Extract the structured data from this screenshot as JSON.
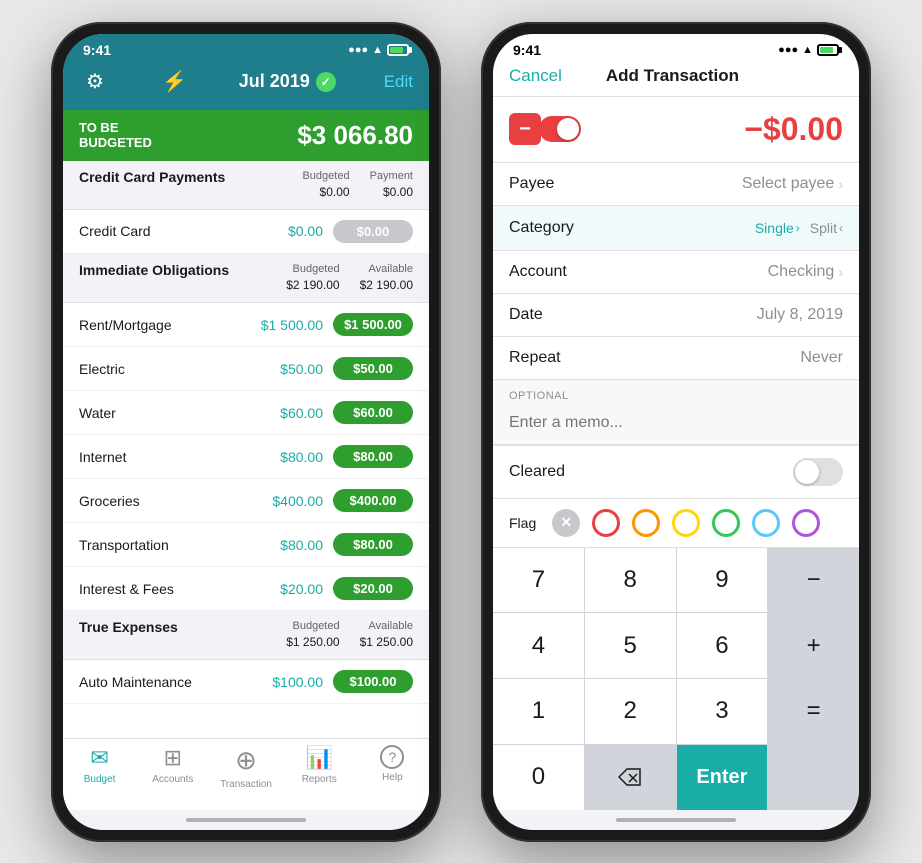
{
  "left_phone": {
    "status_bar": {
      "time": "9:41",
      "signal": "●●●",
      "wifi": "wifi",
      "battery": "battery"
    },
    "header": {
      "gear_icon": "⚙",
      "lightning_icon": "⚡",
      "month": "Jul 2019",
      "edit_label": "Edit"
    },
    "to_be_budgeted": {
      "label": "TO BE\nBUDGETED",
      "amount": "$3 066.80"
    },
    "groups": [
      {
        "title": "Credit Card Payments",
        "meta_label1": "Budgeted",
        "meta_val1": "$0.00",
        "meta_label2": "Payment",
        "meta_val2": "$0.00",
        "rows": [
          {
            "name": "Credit Card",
            "budgeted": "$0.00",
            "available": "$0.00",
            "available_style": "grey"
          }
        ]
      },
      {
        "title": "Immediate Obligations",
        "meta_label1": "Budgeted",
        "meta_val1": "$2 190.00",
        "meta_label2": "Available",
        "meta_val2": "$2 190.00",
        "rows": [
          {
            "name": "Rent/Mortgage",
            "budgeted": "$1 500.00",
            "available": "$1 500.00",
            "available_style": "green"
          },
          {
            "name": "Electric",
            "budgeted": "$50.00",
            "available": "$50.00",
            "available_style": "green"
          },
          {
            "name": "Water",
            "budgeted": "$60.00",
            "available": "$60.00",
            "available_style": "green"
          },
          {
            "name": "Internet",
            "budgeted": "$80.00",
            "available": "$80.00",
            "available_style": "green"
          },
          {
            "name": "Groceries",
            "budgeted": "$400.00",
            "available": "$400.00",
            "available_style": "green"
          },
          {
            "name": "Transportation",
            "budgeted": "$80.00",
            "available": "$80.00",
            "available_style": "green"
          },
          {
            "name": "Interest & Fees",
            "budgeted": "$20.00",
            "available": "$20.00",
            "available_style": "green"
          }
        ]
      },
      {
        "title": "True Expenses",
        "meta_label1": "Budgeted",
        "meta_val1": "$1 250.00",
        "meta_label2": "Available",
        "meta_val2": "$1 250.00",
        "rows": [
          {
            "name": "Auto Maintenance",
            "budgeted": "$100.00",
            "available": "$100.00",
            "available_style": "green"
          }
        ]
      }
    ],
    "tabs": [
      {
        "icon": "✉",
        "label": "Budget",
        "active": true
      },
      {
        "icon": "⊞",
        "label": "Accounts",
        "active": false
      },
      {
        "icon": "⊕",
        "label": "Transaction",
        "active": false
      },
      {
        "icon": "📊",
        "label": "Reports",
        "active": false
      },
      {
        "icon": "?",
        "label": "Help",
        "active": false
      }
    ]
  },
  "right_phone": {
    "status_bar": {
      "time": "9:41"
    },
    "nav": {
      "cancel_label": "Cancel",
      "title": "Add Transaction"
    },
    "amount": {
      "sign": "−",
      "value": "−$0.00"
    },
    "form_rows": [
      {
        "label": "Payee",
        "value": "Select payee",
        "has_chevron": true
      },
      {
        "label": "Category",
        "value_single": "Single",
        "value_split": "Split",
        "has_arrows": true
      },
      {
        "label": "Account",
        "value": "Checking",
        "has_chevron": true
      },
      {
        "label": "Date",
        "value": "July 8, 2019",
        "has_chevron": false
      },
      {
        "label": "Repeat",
        "value": "Never",
        "has_chevron": false
      }
    ],
    "optional_label": "OPTIONAL",
    "memo_placeholder": "Enter a memo...",
    "cleared_label": "Cleared",
    "flag_label": "Flag",
    "numpad": {
      "keys": [
        "7",
        "8",
        "9",
        "−",
        "4",
        "5",
        "6",
        "+",
        "1",
        "2",
        "3",
        "=",
        "0",
        "⌫",
        "Enter"
      ],
      "enter_label": "Enter"
    }
  }
}
